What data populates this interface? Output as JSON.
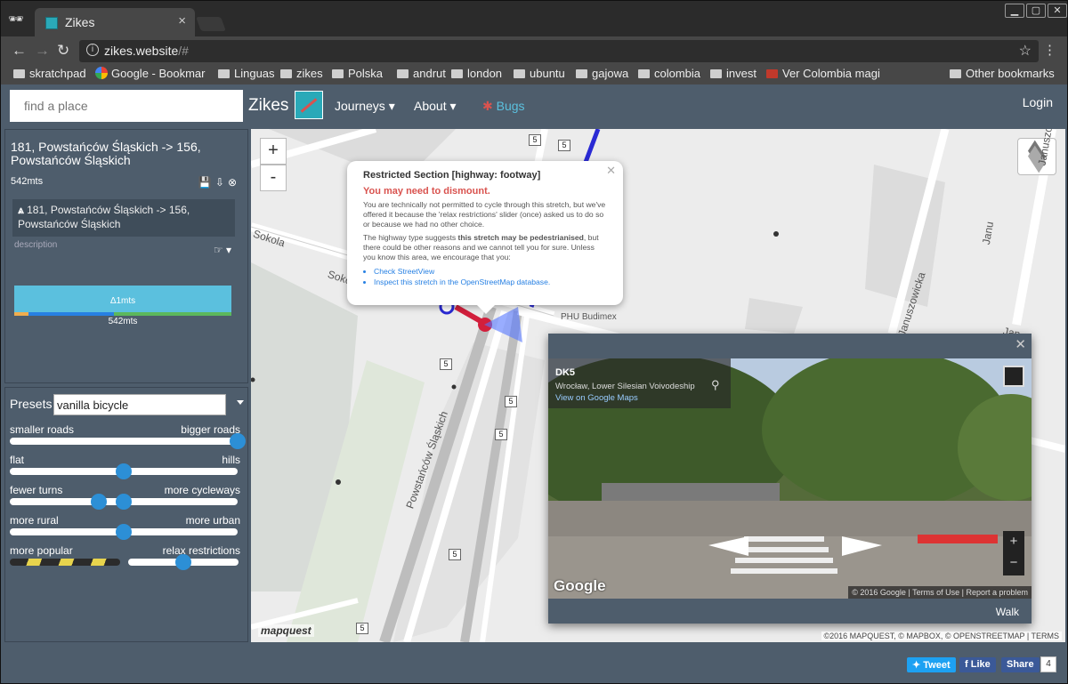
{
  "browser": {
    "tab_title": "Zikes",
    "tab_close": "×",
    "url_host": "zikes.website",
    "url_path": "/#",
    "bookmarks": [
      {
        "label": "skratchpad",
        "icon": "folder-icon"
      },
      {
        "label": "Google - Bookmar",
        "icon": "google-icon"
      },
      {
        "label": "Linguas",
        "icon": "folder-icon"
      },
      {
        "label": "zikes",
        "icon": "folder-icon"
      },
      {
        "label": "Polska",
        "icon": "folder-icon"
      },
      {
        "label": "andrut",
        "icon": "folder-icon"
      },
      {
        "label": "london",
        "icon": "folder-icon"
      },
      {
        "label": "ubuntu",
        "icon": "folder-icon"
      },
      {
        "label": "gajowa",
        "icon": "folder-icon"
      },
      {
        "label": "colombia",
        "icon": "folder-icon"
      },
      {
        "label": "invest",
        "icon": "folder-icon"
      },
      {
        "label": "Ver Colombia magi",
        "icon": "site-icon"
      }
    ],
    "other_bookmarks": "Other bookmarks"
  },
  "navbar": {
    "search_placeholder": "find a place",
    "brand": "Zikes",
    "journeys": "Journeys ▾",
    "about": "About ▾",
    "bugs": "Bugs",
    "login": "Login"
  },
  "journey": {
    "title": "181, Powstańców Śląskich -> 156, Powstańców Śląskich",
    "distance": "542mts",
    "segment_text": "181, Powstańców Śląskich -> 156, Powstańców Śląskich",
    "description_placeholder": "description",
    "elevation_label": "Δ1mts",
    "total": "542mts"
  },
  "presets": {
    "label": "Presets",
    "value": "vanilla bicycle",
    "sliders": [
      {
        "left": "smaller roads",
        "right": "bigger roads",
        "value": 1.0
      },
      {
        "left": "flat",
        "right": "hills",
        "value": 0.5
      },
      {
        "left": "fewer turns",
        "right": "more cycleways",
        "value": 0.5
      },
      {
        "left": "more rural",
        "right": "more urban",
        "value": 0.5
      },
      {
        "left": "more popular",
        "right": "relax restrictions",
        "value": 0.5
      }
    ]
  },
  "map": {
    "zoom_in": "+",
    "zoom_out": "-",
    "labels": {
      "powstancow": "Powstańców Śląskich",
      "sokola": "Sokola",
      "soko": "Soko",
      "januszo_top": "Januszo",
      "janusz_mid": "Janu",
      "januszowicka": "Januszowicka",
      "phu": "PHU Budimex",
      "jan_right": "Jan"
    },
    "road_numbers": [
      "5",
      "5",
      "5",
      "5",
      "5",
      "5",
      "5",
      "5"
    ],
    "popup": {
      "title": "Restricted Section [highway: footway]",
      "warning": "You may need to dismount.",
      "p1": "You are technically not permitted to cycle through this stretch, but we've offered it because the 'relax restrictions' slider (once) asked us to do so or because we had no other choice.",
      "p2_a": "The highway type suggests ",
      "p2_b": "this stretch may be pedestrianised",
      "p2_c": ", but there could be other reasons and we cannot tell you for sure. Unless you know this area, we encourage that you:",
      "link1": "Check StreetView",
      "link2": "Inspect this stretch in the OpenStreetMap database."
    },
    "streetview": {
      "title": "DK5",
      "location": "Wrocław, Lower Silesian Voivodeship",
      "link": "View on Google Maps",
      "google": "Google",
      "footer": "© 2016 Google  |  Terms of Use  |  Report a problem",
      "mode": "Walk",
      "zoom_in": "+",
      "zoom_out": "−"
    },
    "attribution": "©2016 MAPQUEST, © MAPBOX, © OPENSTREETMAP | TERMS",
    "mapquest": "mapquest"
  },
  "footer": {
    "tweet": "Tweet",
    "like": "Like",
    "share": "Share",
    "count": "4"
  }
}
